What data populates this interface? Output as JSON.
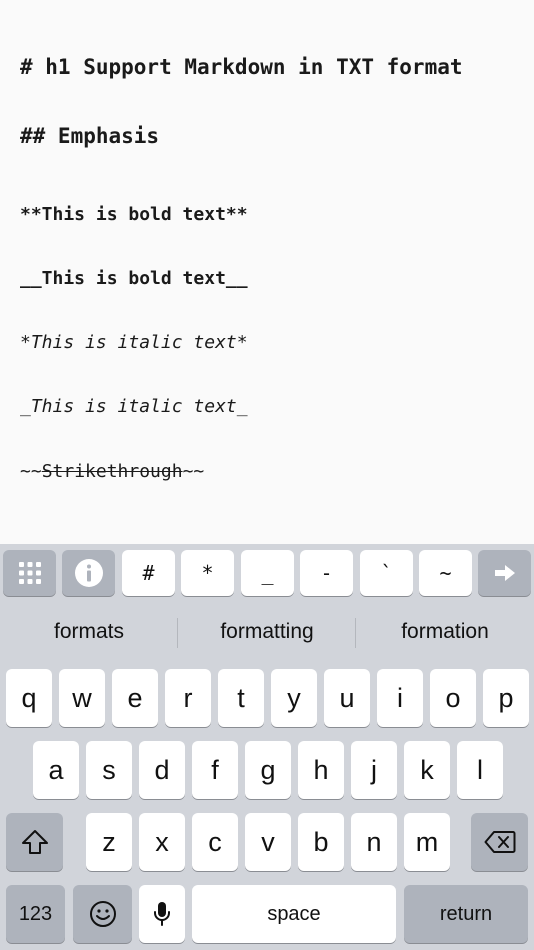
{
  "editor": {
    "lines": [
      "# h1 Support Markdown in TXT format",
      "## Emphasis",
      "**This is bold text**",
      "__This is bold text__",
      "*This is italic text*",
      "_This is italic text_"
    ],
    "strike": {
      "prefix": "~~",
      "text": "Strikethrough",
      "suffix": "~~"
    }
  },
  "toolbar": {
    "keys": [
      "#",
      "*",
      "_",
      "-",
      "`",
      "~"
    ],
    "icons": {
      "grid": "keypad-grid-icon",
      "info": "info-icon",
      "arrow": "arrow-right-icon"
    }
  },
  "suggestions": [
    "formats",
    "formatting",
    "formation"
  ],
  "keyboard": {
    "row1": [
      "q",
      "w",
      "e",
      "r",
      "t",
      "y",
      "u",
      "i",
      "o",
      "p"
    ],
    "row2": [
      "a",
      "s",
      "d",
      "f",
      "g",
      "h",
      "j",
      "k",
      "l"
    ],
    "row3": [
      "z",
      "x",
      "c",
      "v",
      "b",
      "n",
      "m"
    ],
    "numbers_label": "123",
    "space_label": "space",
    "return_label": "return",
    "icons": {
      "shift": "shift-icon",
      "delete": "delete-icon",
      "emoji": "emoji-icon",
      "mic": "microphone-icon"
    }
  },
  "colors": {
    "key": "#ffffff",
    "key_dark": "#aeb3bc",
    "keyboard_bg": "#d1d4da",
    "editor_bg": "#fafafa"
  }
}
